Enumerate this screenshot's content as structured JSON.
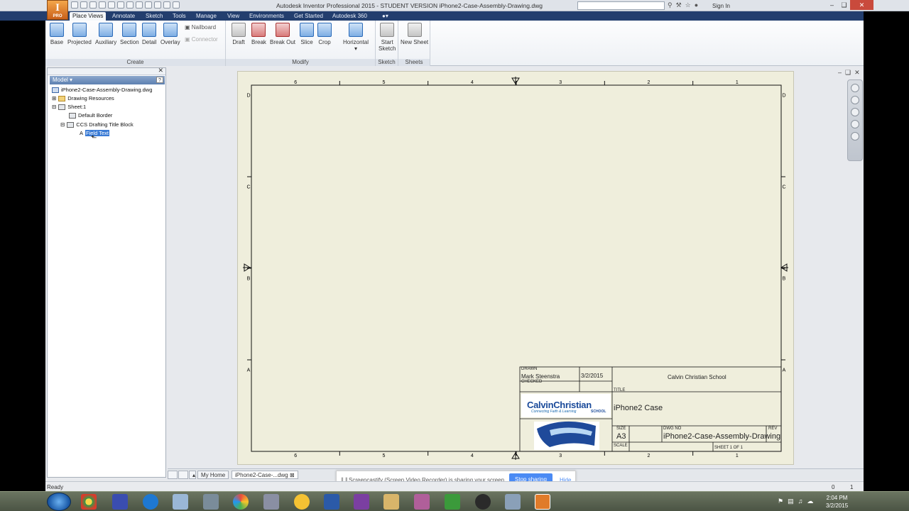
{
  "app": {
    "title": "Autodesk Inventor Professional 2015 - STUDENT VERSION   iPhone2-Case-Assembly-Drawing.dwg",
    "app_button_letter": "I",
    "app_button_sub": "PRO",
    "sign_in": "Sign In"
  },
  "tabs": [
    "Place Views",
    "Annotate",
    "Sketch",
    "Tools",
    "Manage",
    "View",
    "Environments",
    "Get Started",
    "Autodesk 360"
  ],
  "ribbon": {
    "create": {
      "label": "Create",
      "buttons": [
        "Base",
        "Projected",
        "Auxiliary",
        "Section",
        "Detail",
        "Overlay"
      ],
      "small": [
        "Nailboard",
        "Connector"
      ]
    },
    "modify": {
      "label": "Modify",
      "buttons": [
        "Draft",
        "Break",
        "Break Out",
        "Slice",
        "Crop",
        "Horizontal"
      ]
    },
    "sketch": {
      "label": "Sketch",
      "button_line1": "Start",
      "button_line2": "Sketch"
    },
    "sheets": {
      "label": "Sheets",
      "button": "New Sheet"
    }
  },
  "browser": {
    "tab": "Model",
    "help": "?",
    "tree": [
      "iPhone2-Case-Assembly-Drawing.dwg",
      "Drawing Resources",
      "Sheet:1",
      "Default Border",
      "CCS Drafting Title Block",
      "Field Text"
    ],
    "selected_item_prefix": "A"
  },
  "sheet": {
    "top_numbers": [
      "6",
      "5",
      "4",
      "3",
      "2",
      "1"
    ],
    "side_letters": [
      "D",
      "C",
      "B",
      "A"
    ],
    "title_block": {
      "drawn_label": "DRAWN",
      "drawn_by": "Mark Steenstra",
      "drawn_date": "3/2/2015",
      "checked_label": "CHECKED",
      "company": "Calvin Christian School",
      "title_label": "TITLE",
      "title": "iPhone2 Case",
      "logo_text": "CalvinChristian",
      "logo_tagline": "Connecting Faith & Learning",
      "logo_school": "SCHOOL",
      "size_label": "SIZE",
      "size": "A3",
      "dwg_no_label": "DWG NO",
      "dwg_no": "iPhone2-Case-Assembly-Drawing",
      "rev_label": "REV",
      "scale_label": "SCALE",
      "sheet_info": "SHEET 1  OF 1"
    }
  },
  "doc_tabs": [
    "My Home",
    "iPhone2-Case-...dwg"
  ],
  "screen_share": {
    "message": "Screencastify (Screen Video Recorder) is sharing your screen.",
    "stop": "Stop sharing",
    "hide": "Hide"
  },
  "status": {
    "ready": "Ready",
    "num1": "0",
    "num2": "1"
  },
  "clock": {
    "time": "2:04 PM",
    "date": "3/2/2015"
  },
  "colors": {
    "ribbon_tabs": "#233e6e",
    "sheet_bg": "#efeedc",
    "share_button": "#4a8af4",
    "app_button": "#e0822e"
  }
}
